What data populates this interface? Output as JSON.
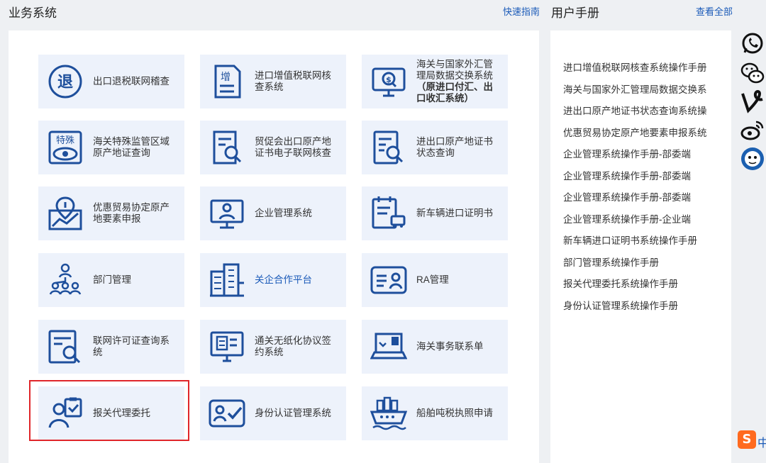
{
  "left_section": {
    "title": "业务系统",
    "quick_guide": "快速指南"
  },
  "right_section": {
    "title": "用户手册",
    "view_all": "查看全部"
  },
  "tiles": [
    {
      "label": "出口退税联网稽查",
      "icon": "tax-refund-icon"
    },
    {
      "label": "进口增值税联网核查系统",
      "icon": "vat-document-icon"
    },
    {
      "label": "海关与国家外汇管理局数据交换系统",
      "label_bold": "（原进口付汇、出口收汇系统）",
      "icon": "monitor-search-icon"
    },
    {
      "label": "海关特殊监管区域原产地证查询",
      "icon": "special-zone-eye-icon"
    },
    {
      "label": "贸促会出口原产地证书电子联网核查",
      "icon": "certificate-search-icon"
    },
    {
      "label": "进出口原产地证书状态查询",
      "icon": "certificate-status-icon"
    },
    {
      "label": "优惠贸易协定原产地要素申报",
      "icon": "map-pin-chart-icon"
    },
    {
      "label": "企业管理系统",
      "icon": "enterprise-user-icon"
    },
    {
      "label": "新车辆进口证明书",
      "icon": "vehicle-certificate-icon"
    },
    {
      "label": "部门管理",
      "icon": "org-chart-icon"
    },
    {
      "label": "关企合作平台",
      "icon": "building-icon",
      "highlight_color": "#1a5ab8"
    },
    {
      "label": "RA管理",
      "icon": "id-card-icon"
    },
    {
      "label": "联网许可证查询系统",
      "icon": "license-search-icon"
    },
    {
      "label": "通关无纸化协议签约系统",
      "icon": "paperless-contract-icon"
    },
    {
      "label": "海关事务联系单",
      "icon": "laptop-contact-icon"
    },
    {
      "label": "报关代理委托",
      "icon": "customs-agent-icon"
    },
    {
      "label": "身份认证管理系统",
      "icon": "identity-check-icon"
    },
    {
      "label": "船舶吨税执照申请",
      "icon": "ship-icon"
    }
  ],
  "manuals": [
    "进口增值税联网核查系统操作手册",
    "海关与国家外汇管理局数据交换系",
    "进出口原产地证书状态查询系统操",
    "优惠贸易协定原产地要素申报系统",
    "企业管理系统操作手册-部委端",
    "企业管理系统操作手册-部委端",
    "企业管理系统操作手册-部委端",
    "企业管理系统操作手册-企业端",
    "新车辆进口证明书系统操作手册",
    "部门管理系统操作手册",
    "报关代理委托系统操作手册",
    "身份认证管理系统操作手册"
  ],
  "social": [
    "whatsapp-icon",
    "wechat-icon",
    "vine-icon",
    "weibo-icon",
    "qq-icon"
  ],
  "tray": {
    "sogou": "S",
    "sogou_mode": "中"
  },
  "colors": {
    "primary": "#1a5ab8",
    "icon": "#1e4f9c",
    "tile_bg": "#edf2fb",
    "highlight": "#e0262a"
  }
}
